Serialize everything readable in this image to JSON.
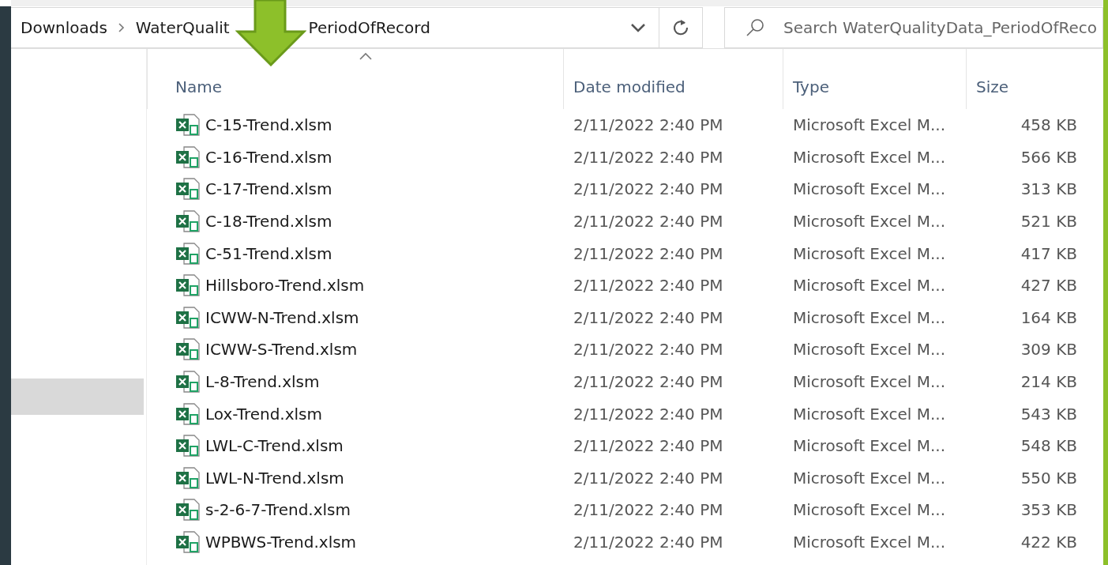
{
  "address_bar": {
    "crumbs": [
      "Downloads",
      "WaterQualit",
      "PeriodOfRecord"
    ]
  },
  "search": {
    "placeholder": "Search WaterQualityData_PeriodOfReco"
  },
  "nav_pane": {
    "selected_item": true
  },
  "table": {
    "columns": [
      {
        "label": "Name",
        "sorted": true
      },
      {
        "label": "Date modified",
        "sorted": false
      },
      {
        "label": "Type",
        "sorted": false
      },
      {
        "label": "Size",
        "sorted": false
      }
    ],
    "rows": [
      {
        "name": "C-15-Trend.xlsm",
        "date": "2/11/2022 2:40 PM",
        "type": "Microsoft Excel M...",
        "size": "458 KB"
      },
      {
        "name": "C-16-Trend.xlsm",
        "date": "2/11/2022 2:40 PM",
        "type": "Microsoft Excel M...",
        "size": "566 KB"
      },
      {
        "name": "C-17-Trend.xlsm",
        "date": "2/11/2022 2:40 PM",
        "type": "Microsoft Excel M...",
        "size": "313 KB"
      },
      {
        "name": "C-18-Trend.xlsm",
        "date": "2/11/2022 2:40 PM",
        "type": "Microsoft Excel M...",
        "size": "521 KB"
      },
      {
        "name": "C-51-Trend.xlsm",
        "date": "2/11/2022 2:40 PM",
        "type": "Microsoft Excel M...",
        "size": "417 KB"
      },
      {
        "name": "Hillsboro-Trend.xlsm",
        "date": "2/11/2022 2:40 PM",
        "type": "Microsoft Excel M...",
        "size": "427 KB"
      },
      {
        "name": "ICWW-N-Trend.xlsm",
        "date": "2/11/2022 2:40 PM",
        "type": "Microsoft Excel M...",
        "size": "164 KB"
      },
      {
        "name": "ICWW-S-Trend.xlsm",
        "date": "2/11/2022 2:40 PM",
        "type": "Microsoft Excel M...",
        "size": "309 KB"
      },
      {
        "name": "L-8-Trend.xlsm",
        "date": "2/11/2022 2:40 PM",
        "type": "Microsoft Excel M...",
        "size": "214 KB"
      },
      {
        "name": "Lox-Trend.xlsm",
        "date": "2/11/2022 2:40 PM",
        "type": "Microsoft Excel M...",
        "size": "543 KB"
      },
      {
        "name": "LWL-C-Trend.xlsm",
        "date": "2/11/2022 2:40 PM",
        "type": "Microsoft Excel M...",
        "size": "548 KB"
      },
      {
        "name": "LWL-N-Trend.xlsm",
        "date": "2/11/2022 2:40 PM",
        "type": "Microsoft Excel M...",
        "size": "550 KB"
      },
      {
        "name": "s-2-6-7-Trend.xlsm",
        "date": "2/11/2022 2:40 PM",
        "type": "Microsoft Excel M...",
        "size": "353 KB"
      },
      {
        "name": "WPBWS-Trend.xlsm",
        "date": "2/11/2022 2:40 PM",
        "type": "Microsoft Excel M...",
        "size": "422 KB"
      }
    ]
  }
}
